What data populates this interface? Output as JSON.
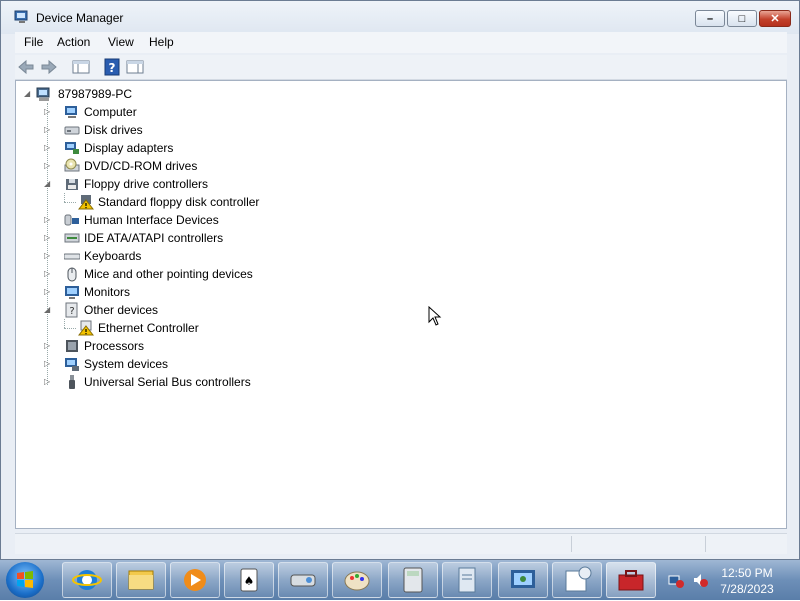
{
  "window": {
    "title": "Device Manager"
  },
  "menu": [
    "File",
    "Action",
    "View",
    "Help"
  ],
  "tree": {
    "root": "87987989-PC",
    "categories": [
      {
        "label": "Computer",
        "icon": "computer-icon",
        "expanded": false
      },
      {
        "label": "Disk drives",
        "icon": "disk-drive-icon",
        "expanded": false
      },
      {
        "label": "Display adapters",
        "icon": "display-adapter-icon",
        "expanded": false
      },
      {
        "label": "DVD/CD-ROM drives",
        "icon": "dvd-drive-icon",
        "expanded": false
      },
      {
        "label": "Floppy drive controllers",
        "icon": "floppy-controller-icon",
        "expanded": true,
        "children": [
          {
            "label": "Standard floppy disk controller",
            "icon": "warning-device-icon"
          }
        ]
      },
      {
        "label": "Human Interface Devices",
        "icon": "hid-icon",
        "expanded": false
      },
      {
        "label": "IDE ATA/ATAPI controllers",
        "icon": "ide-controller-icon",
        "expanded": false
      },
      {
        "label": "Keyboards",
        "icon": "keyboard-icon",
        "expanded": false
      },
      {
        "label": "Mice and other pointing devices",
        "icon": "mouse-icon",
        "expanded": false
      },
      {
        "label": "Monitors",
        "icon": "monitor-icon",
        "expanded": false
      },
      {
        "label": "Other devices",
        "icon": "unknown-device-icon",
        "expanded": true,
        "children": [
          {
            "label": "Ethernet Controller",
            "icon": "warning-device-icon"
          }
        ]
      },
      {
        "label": "Processors",
        "icon": "processor-icon",
        "expanded": false
      },
      {
        "label": "System devices",
        "icon": "system-devices-icon",
        "expanded": false
      },
      {
        "label": "Universal Serial Bus controllers",
        "icon": "usb-icon",
        "expanded": false
      }
    ]
  },
  "taskbar": {
    "clock_time": "12:50 PM",
    "clock_date": "7/28/2023",
    "buttons": [
      "internet-explorer-icon",
      "file-explorer-icon",
      "media-player-icon",
      "solitaire-icon",
      "projector-icon",
      "paint-icon",
      "calculator-icon",
      "document-icon",
      "control-panel-icon",
      "calendar-icon",
      "toolbox-icon"
    ]
  },
  "colors": {
    "accent": "#1b6fc9",
    "close": "#c3412b",
    "warning": "#f2c200"
  }
}
